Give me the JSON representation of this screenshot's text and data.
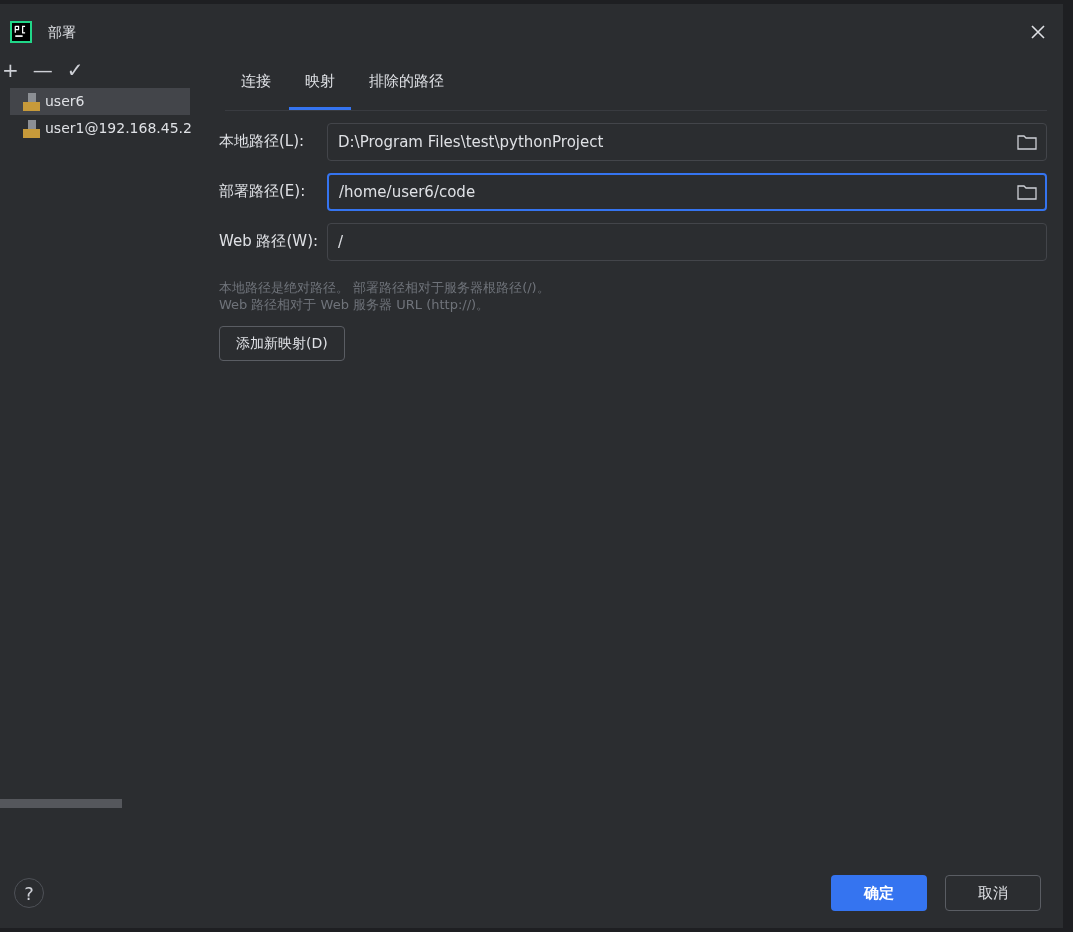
{
  "window": {
    "title": "部署"
  },
  "toolbar": {
    "add": "+",
    "remove": "—",
    "apply": "✓"
  },
  "servers": [
    {
      "name": "user6",
      "selected": true
    },
    {
      "name": "user1@192.168.45.2",
      "selected": false
    }
  ],
  "tabs": [
    {
      "label": "连接",
      "selected": false
    },
    {
      "label": "映射",
      "selected": true
    },
    {
      "label": "排除的路径",
      "selected": false
    }
  ],
  "fields": [
    {
      "label": "本地路径(L):",
      "value": "D:\\Program Files\\test\\pythonProject",
      "focused": false,
      "browse": true
    },
    {
      "label": "部署路径(E):",
      "value": "/home/user6/code",
      "focused": true,
      "browse": true
    },
    {
      "label": "Web 路径(W):",
      "value": "/",
      "focused": false,
      "browse": false
    }
  ],
  "hint": [
    "本地路径是绝对路径。 部署路径相对于服务器根路径(/)。",
    "Web 路径相对于 Web 服务器 URL (http://)。"
  ],
  "add_mapping_button": "添加新映射(D)",
  "help": "?",
  "buttons": [
    {
      "label": "确定",
      "kind": "primary"
    },
    {
      "label": "取消",
      "kind": "secondary"
    }
  ]
}
